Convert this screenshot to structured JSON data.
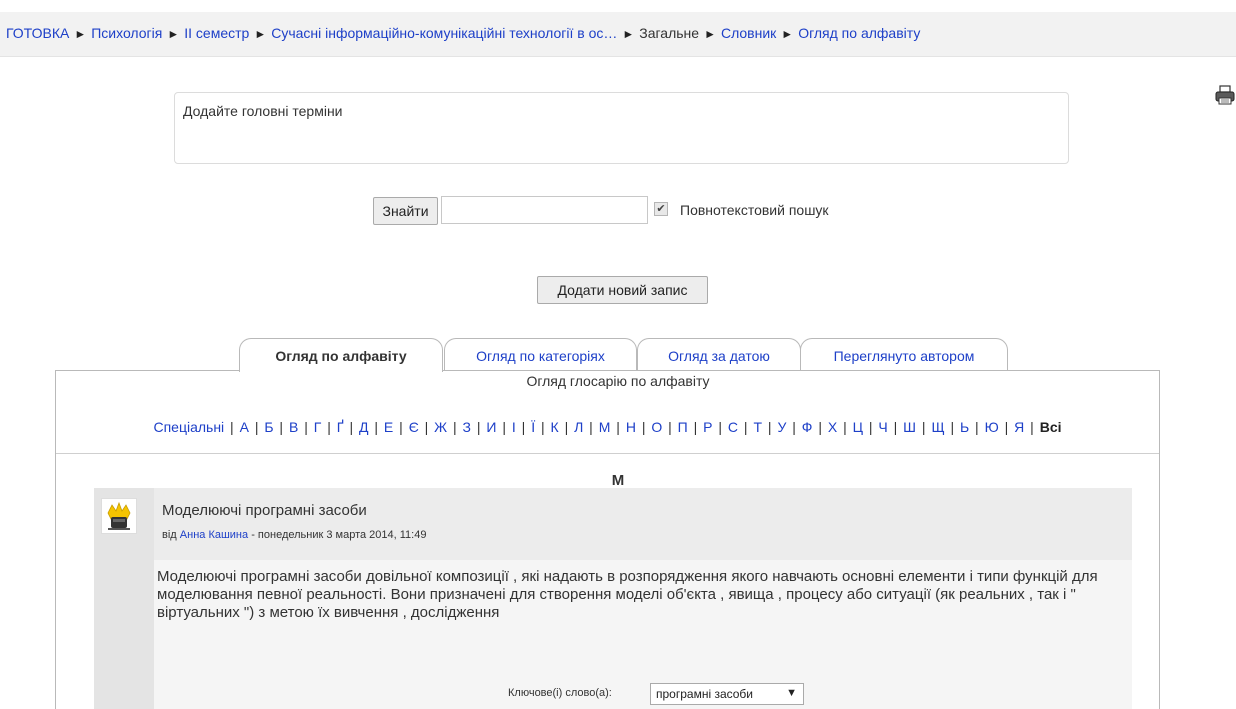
{
  "breadcrumb": {
    "items": [
      "ГОТОВКА",
      "Психологія",
      "ІІ семестр",
      "Сучасні інформаційно-комунікаційні технології в ос…",
      "Загальне",
      "Словник",
      "Огляд по алфавіту"
    ],
    "separator": "►"
  },
  "icons": {
    "print": "print-icon",
    "avatar": "user-avatar"
  },
  "description": "Додайте головні терміни",
  "search": {
    "button_label": "Знайти",
    "value": "",
    "fulltext_label": "Повнотекстовий пошук",
    "fulltext_checked": true
  },
  "add_entry_label": "Додати новий запис",
  "tabs": [
    {
      "label": "Огляд по алфавіту",
      "active": true
    },
    {
      "label": "Огляд по категоріях",
      "active": false
    },
    {
      "label": "Огляд за датою",
      "active": false
    },
    {
      "label": "Переглянуто автором",
      "active": false
    }
  ],
  "panel_subtitle": "Огляд глосарію по алфавіту",
  "alphabet": {
    "special": "Спеціальні",
    "letters": [
      "А",
      "Б",
      "В",
      "Г",
      "Ґ",
      "Д",
      "Е",
      "Є",
      "Ж",
      "З",
      "И",
      "І",
      "Ї",
      "К",
      "Л",
      "М",
      "Н",
      "О",
      "П",
      "Р",
      "С",
      "Т",
      "У",
      "Ф",
      "Х",
      "Ц",
      "Ч",
      "Ш",
      "Щ",
      "Ь",
      "Ю",
      "Я"
    ],
    "all": "Всі"
  },
  "letter_heading": "М",
  "entry": {
    "title": "Моделюючі програмні засоби",
    "meta_prefix": "від",
    "author": "Анна Кашина",
    "date": "- понедельник 3 марта 2014, 11:49",
    "text": "Моделюючі програмні засоби довільної композиції , які надають в розпорядження якого навчають основні елементи і типи функцій для моделювання певної реальності. Вони призначені для створення моделі об'єкта , явища , процесу або ситуації (як реальних , так і \" віртуальних \") з метою їх вивчення , дослідження",
    "keywords_label": "Ключове(і) слово(а):",
    "keyword_selected": "програмні засоби"
  },
  "colors": {
    "link": "#1e40c8",
    "navbar": "#f2f2f2",
    "entry_header": "#ececec",
    "entry_body": "#f5f5f5"
  }
}
